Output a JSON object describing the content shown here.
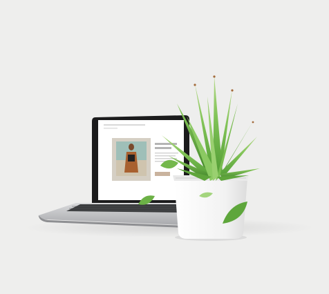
{
  "scene": {
    "description_objects": [
      "laptop",
      "succulent-plant",
      "white-planter",
      "floating-leaves"
    ],
    "colors": {
      "background": "#eeeeed",
      "laptop_body": "#cfd0d2",
      "screen_bezel": "#1b1b1c",
      "planter": "#f7f7f7",
      "leaf_green": "#7cc04f",
      "leaf_dark": "#4c8d2e",
      "plant_tip": "#a36a3a"
    }
  },
  "laptop_screen": {
    "nav_text": "",
    "nav_sub": "",
    "headline": "",
    "description": "",
    "button_label": ""
  }
}
